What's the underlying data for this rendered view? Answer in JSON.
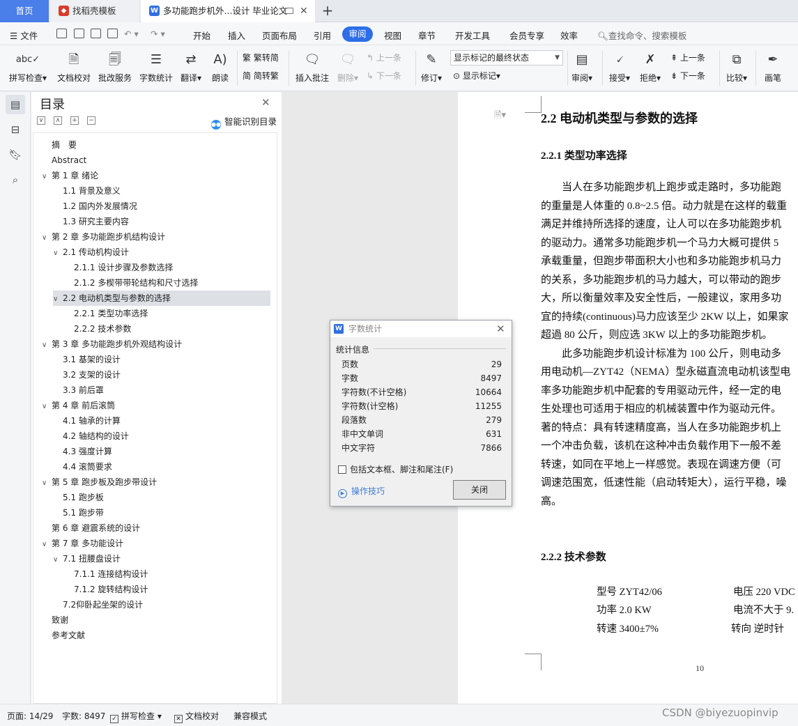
{
  "tabs": {
    "home": "首页",
    "template": "找稻壳模板",
    "document": "多功能跑步机外...设计 毕业论文"
  },
  "menu": {
    "file": "文件",
    "items": [
      "开始",
      "插入",
      "页面布局",
      "引用",
      "视图",
      "章节",
      "开发工具",
      "会员专享",
      "效率"
    ],
    "active": "审阅",
    "search": "查找命令、搜索模板"
  },
  "ribbon": {
    "spell": "拼写检查",
    "proof": "文档校对",
    "review_service": "批改服务",
    "word_count": "字数统计",
    "translate": "翻译",
    "read_aloud": "朗读",
    "trad": "繁转简",
    "simp": "简转繁",
    "insert_comment": "插入批注",
    "delete": "删除",
    "prev_comment": "上一条",
    "next_comment": "下一条",
    "revise": "修订",
    "markup_state": "显示标记的最终状态",
    "show_markup": "显示标记",
    "review": "审阅",
    "accept": "接受",
    "reject": "拒绝",
    "prev_change": "上一条",
    "next_change": "下一条",
    "compare": "比较",
    "pen": "画笔"
  },
  "toc": {
    "title": "目录",
    "smart": "智能识别目录",
    "items": [
      {
        "text": "摘　要",
        "level": 0,
        "arrow": ""
      },
      {
        "text": "Abstract",
        "level": 0,
        "arrow": ""
      },
      {
        "text": "第 1 章  绪论",
        "level": 0,
        "arrow": "∨"
      },
      {
        "text": "1.1 背景及意义",
        "level": 1,
        "arrow": ""
      },
      {
        "text": "1.2 国内外发展情况",
        "level": 1,
        "arrow": ""
      },
      {
        "text": "1.3 研究主要内容",
        "level": 1,
        "arrow": ""
      },
      {
        "text": "第 2 章  多功能跑步机结构设计",
        "level": 0,
        "arrow": "∨"
      },
      {
        "text": "2.1  传动机构设计",
        "level": 1,
        "arrow": "∨"
      },
      {
        "text": "2.1.1  设计步骤及参数选择",
        "level": 2,
        "arrow": ""
      },
      {
        "text": "2.1.2 多楔带带轮结构和尺寸选择",
        "level": 2,
        "arrow": ""
      },
      {
        "text": "2.2  电动机类型与参数的选择",
        "level": 1,
        "arrow": "∨",
        "selected": true
      },
      {
        "text": "2.2.1 类型功率选择",
        "level": 2,
        "arrow": ""
      },
      {
        "text": "2.2.2 技术参数",
        "level": 2,
        "arrow": ""
      },
      {
        "text": "第 3 章  多功能跑步机外观结构设计",
        "level": 0,
        "arrow": "∨"
      },
      {
        "text": "3.1 基架的设计",
        "level": 1,
        "arrow": ""
      },
      {
        "text": "3.2 支架的设计",
        "level": 1,
        "arrow": ""
      },
      {
        "text": "3.3 前后罩",
        "level": 1,
        "arrow": ""
      },
      {
        "text": "第 4 章  前后滚筒",
        "level": 0,
        "arrow": "∨"
      },
      {
        "text": "4.1 轴承的计算",
        "level": 1,
        "arrow": ""
      },
      {
        "text": "4.2 轴结构的设计",
        "level": 1,
        "arrow": ""
      },
      {
        "text": "4.3 强度计算",
        "level": 1,
        "arrow": ""
      },
      {
        "text": "4.4 滚筒要求",
        "level": 1,
        "arrow": ""
      },
      {
        "text": "第 5 章  跑步板及跑步带设计",
        "level": 0,
        "arrow": "∨"
      },
      {
        "text": "5.1 跑步板",
        "level": 1,
        "arrow": ""
      },
      {
        "text": "5.1 跑步带",
        "level": 1,
        "arrow": ""
      },
      {
        "text": "第 6 章  避震系统的设计",
        "level": 0,
        "arrow": ""
      },
      {
        "text": "第 7 章  多功能设计",
        "level": 0,
        "arrow": "∨"
      },
      {
        "text": "7.1 扭腰盘设计",
        "level": 1,
        "arrow": "∨"
      },
      {
        "text": "7.1.1 连接结构设计",
        "level": 2,
        "arrow": ""
      },
      {
        "text": "7.1.2 旋转结构设计",
        "level": 2,
        "arrow": ""
      },
      {
        "text": "7.2仰卧起坐架的设计",
        "level": 1,
        "arrow": ""
      },
      {
        "text": "致谢",
        "level": 0,
        "arrow": ""
      },
      {
        "text": "参考文献",
        "level": 0,
        "arrow": ""
      }
    ]
  },
  "document": {
    "heading": "2.2  电动机类型与参数的选择",
    "sub1": "2.2.1 类型功率选择",
    "lines": [
      "　　当人在多功能跑步机上跑步或走路时，多功能跑",
      "的重量是人体重的 0.8~2.5 倍。动力就是在这样的载重",
      "满足并维持所选择的速度，让人可以在多功能跑步机",
      "的驱动力。通常多功能跑步机一个马力大概可提供 5",
      "承载重量，但跑步带面积大小也和多功能跑步机马力",
      "的关系，多功能跑步机的马力越大，可以带动的跑步",
      "大，所以衡量效率及安全性后，一般建议，家用多功",
      "宜的持续(continuous)马力应该至少 2KW 以上，如果家",
      "超過 80 公斤，则应选 3KW 以上的多功能跑步机。",
      "　　此多功能跑步机设计标准为 100 公斤，则电动多",
      "用电动机—ZYT42（NEMA）型永磁直流电动机该型电",
      " 率多功能跑步机中配套的专用驱动元件，经一定的电",
      " 生处理也可适用于相应的机械装置中作为驱动元件。",
      " 著的特点：具有转速精度高，当人在多功能跑步机上",
      " 一个冲击负载，该机在这种冲击负载作用下一般不差",
      "转速，如同在平地上一样感觉。表现在调速方便（可",
      "调速范围宽，低速性能（启动转矩大），运行平稳，噪",
      "高。"
    ],
    "sub2": "2.2.2 技术参数",
    "params": [
      {
        "left": "型号  ZYT42/06",
        "right": "电压 220 VDC"
      },
      {
        "left": "功率  2.0 KW",
        "right": "电流不大于 9."
      },
      {
        "left": "转速 3400±7%",
        "right": "转向  逆时针"
      }
    ],
    "page_number": "10"
  },
  "dialog": {
    "title": "字数统计",
    "section": "统计信息",
    "stats": [
      {
        "label": "页数",
        "value": "29"
      },
      {
        "label": "字数",
        "value": "8497"
      },
      {
        "label": "字符数(不计空格)",
        "value": "10664"
      },
      {
        "label": "字符数(计空格)",
        "value": "11255"
      },
      {
        "label": "段落数",
        "value": "279"
      },
      {
        "label": "非中文单词",
        "value": "631"
      },
      {
        "label": "中文字符",
        "value": "7866"
      }
    ],
    "checkbox": "包括文本框、脚注和尾注(F)",
    "tips": "操作技巧",
    "close": "关闭"
  },
  "status": {
    "page": "页面: 14/29",
    "words": "字数: 8497",
    "spell": "拼写检查",
    "proof": "文档校对",
    "compat": "兼容模式"
  },
  "watermark": "CSDN @biyezuopinvip"
}
